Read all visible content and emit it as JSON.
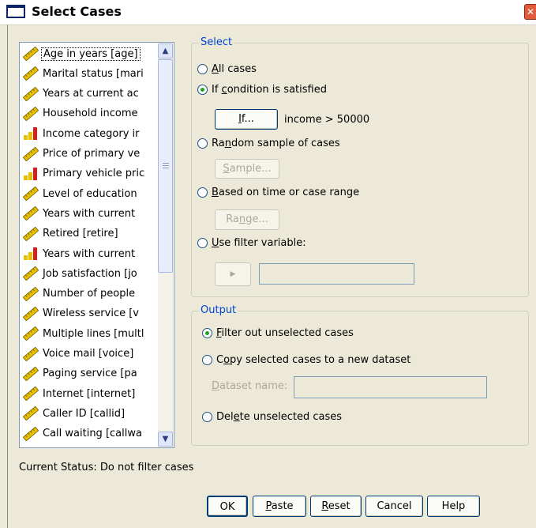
{
  "window": {
    "title": "Select Cases",
    "close_glyph": "✕"
  },
  "variables": [
    {
      "label": "Age in years [age]",
      "icon": "scale-ruler-icon"
    },
    {
      "label": "Marital status [mari",
      "icon": "scale-ruler-icon"
    },
    {
      "label": "Years at current ac",
      "icon": "scale-ruler-icon"
    },
    {
      "label": "Household income",
      "icon": "scale-ruler-icon"
    },
    {
      "label": "Income category ir",
      "icon": "ordinal-bar-icon"
    },
    {
      "label": "Price of primary ve",
      "icon": "scale-ruler-icon"
    },
    {
      "label": "Primary vehicle pric",
      "icon": "ordinal-bar-icon"
    },
    {
      "label": "Level of education",
      "icon": "scale-ruler-icon"
    },
    {
      "label": "Years with current",
      "icon": "scale-ruler-icon"
    },
    {
      "label": "Retired [retire]",
      "icon": "scale-ruler-icon"
    },
    {
      "label": "Years with current",
      "icon": "ordinal-bar-icon"
    },
    {
      "label": "Job satisfaction [jo",
      "icon": "scale-ruler-icon"
    },
    {
      "label": "Number of people",
      "icon": "scale-ruler-icon"
    },
    {
      "label": "Wireless service [v",
      "icon": "scale-ruler-icon"
    },
    {
      "label": "Multiple lines [multl",
      "icon": "scale-ruler-icon"
    },
    {
      "label": "Voice mail [voice]",
      "icon": "scale-ruler-icon"
    },
    {
      "label": "Paging service [pa",
      "icon": "scale-ruler-icon"
    },
    {
      "label": "Internet [internet]",
      "icon": "scale-ruler-icon"
    },
    {
      "label": "Caller ID [callid]",
      "icon": "scale-ruler-icon"
    },
    {
      "label": "Call waiting [callwa",
      "icon": "scale-ruler-icon"
    }
  ],
  "select": {
    "legend": "Select",
    "all_cases": {
      "pre": "",
      "key": "A",
      "post": "ll cases",
      "selected": false
    },
    "if_condition": {
      "pre": "If ",
      "key": "c",
      "post": "ondition is satisfied",
      "selected": true
    },
    "if_button": {
      "key": "I",
      "post": "f..."
    },
    "condition_text": "income > 50000",
    "random_sample": {
      "pre": "Ra",
      "key": "n",
      "post": "dom sample of cases",
      "selected": false
    },
    "sample_button": {
      "key": "S",
      "post": "ample..."
    },
    "based_on_time": {
      "pre": "",
      "key": "B",
      "post": "ased on time or case range",
      "selected": false
    },
    "range_button": {
      "pre": "Ra",
      "key": "n",
      "post": "ge..."
    },
    "use_filter": {
      "pre": "",
      "key": "U",
      "post": "se filter variable:",
      "selected": false
    },
    "arrow_button": "▶",
    "filter_value": ""
  },
  "output": {
    "legend": "Output",
    "filter_out": {
      "pre": "",
      "key": "F",
      "post": "ilter out unselected cases",
      "selected": true
    },
    "copy_selected": {
      "pre": "C",
      "key": "o",
      "post": "py selected cases to a new dataset",
      "selected": false
    },
    "dataset_name_label": {
      "pre": "",
      "key": "D",
      "post": "ataset name:"
    },
    "dataset_name_value": "",
    "delete_unselected": {
      "pre": "Del",
      "key": "e",
      "post": "te unselected cases",
      "selected": false
    }
  },
  "status": "Current Status: Do not filter cases",
  "buttons": {
    "ok": "OK",
    "paste": {
      "key": "P",
      "post": "aste"
    },
    "reset": {
      "key": "R",
      "post": "eset"
    },
    "cancel": "Cancel",
    "help": "Help"
  },
  "colors": {
    "group_legend": "#0046d5",
    "radio_dot": "#21a121",
    "dialog_bg": "#ece9d8",
    "ruler_icon": "#e8c000",
    "ordinal_icon_red": "#d42020"
  }
}
